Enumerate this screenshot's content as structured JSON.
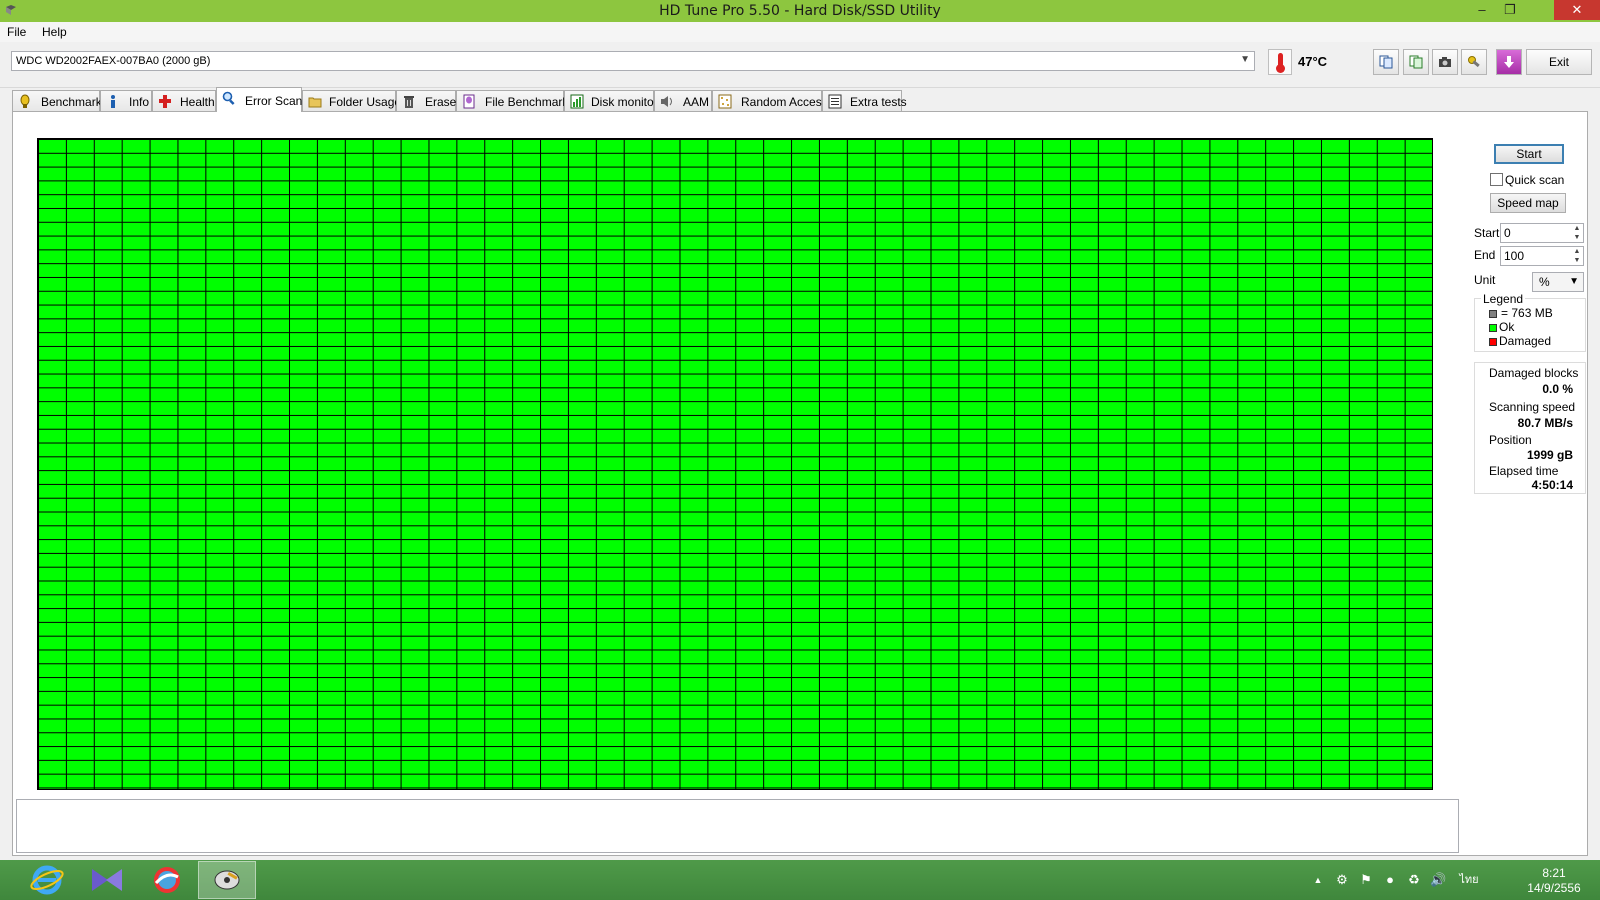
{
  "window": {
    "title": "HD Tune Pro 5.50 - Hard Disk/SSD Utility"
  },
  "menu": {
    "file": "File",
    "help": "Help"
  },
  "toolbar": {
    "drive": "WDC WD2002FAEX-007BA0 (2000 gB)",
    "temperature": "47°C",
    "exit_label": "Exit"
  },
  "tabs": [
    {
      "label": "Benchmark"
    },
    {
      "label": "Info"
    },
    {
      "label": "Health"
    },
    {
      "label": "Error Scan"
    },
    {
      "label": "Folder Usage"
    },
    {
      "label": "Erase"
    },
    {
      "label": "File Benchmark"
    },
    {
      "label": "Disk monitor"
    },
    {
      "label": "AAM"
    },
    {
      "label": "Random Access"
    },
    {
      "label": "Extra tests"
    }
  ],
  "active_tab": "Error Scan",
  "controls": {
    "start_label": "Start",
    "quick_scan_label": "Quick scan",
    "quick_scan_checked": false,
    "speed_map_label": "Speed map",
    "start_field_label": "Start",
    "start_value": "0",
    "end_field_label": "End",
    "end_value": "100",
    "unit_label": "Unit",
    "unit_value": "%"
  },
  "legend": {
    "title": "Legend",
    "block_size": "= 763 MB",
    "ok": "Ok",
    "damaged": "Damaged",
    "colors": {
      "block": "#808080",
      "ok": "#00ff00",
      "damaged": "#ff0000"
    }
  },
  "stats": {
    "damaged_blocks_label": "Damaged blocks",
    "damaged_blocks_value": "0.0 %",
    "scanning_speed_label": "Scanning speed",
    "scanning_speed_value": "80.7 MB/s",
    "position_label": "Position",
    "position_value": "1999 gB",
    "elapsed_label": "Elapsed time",
    "elapsed_value": "4:50:14"
  },
  "block_map": {
    "status": "all blocks ok",
    "ok_color": "#00ff00"
  },
  "taskbar": {
    "apps": [
      "internet-explorer-icon",
      "visual-studio-icon",
      "app-icon",
      "hdtune-icon"
    ],
    "language": "ไทย",
    "time": "8:21",
    "date": "14/9/2556"
  },
  "colors": {
    "titlebar": "#8dc63f",
    "taskbar": "#4f9a49",
    "close": "#c7372f"
  }
}
